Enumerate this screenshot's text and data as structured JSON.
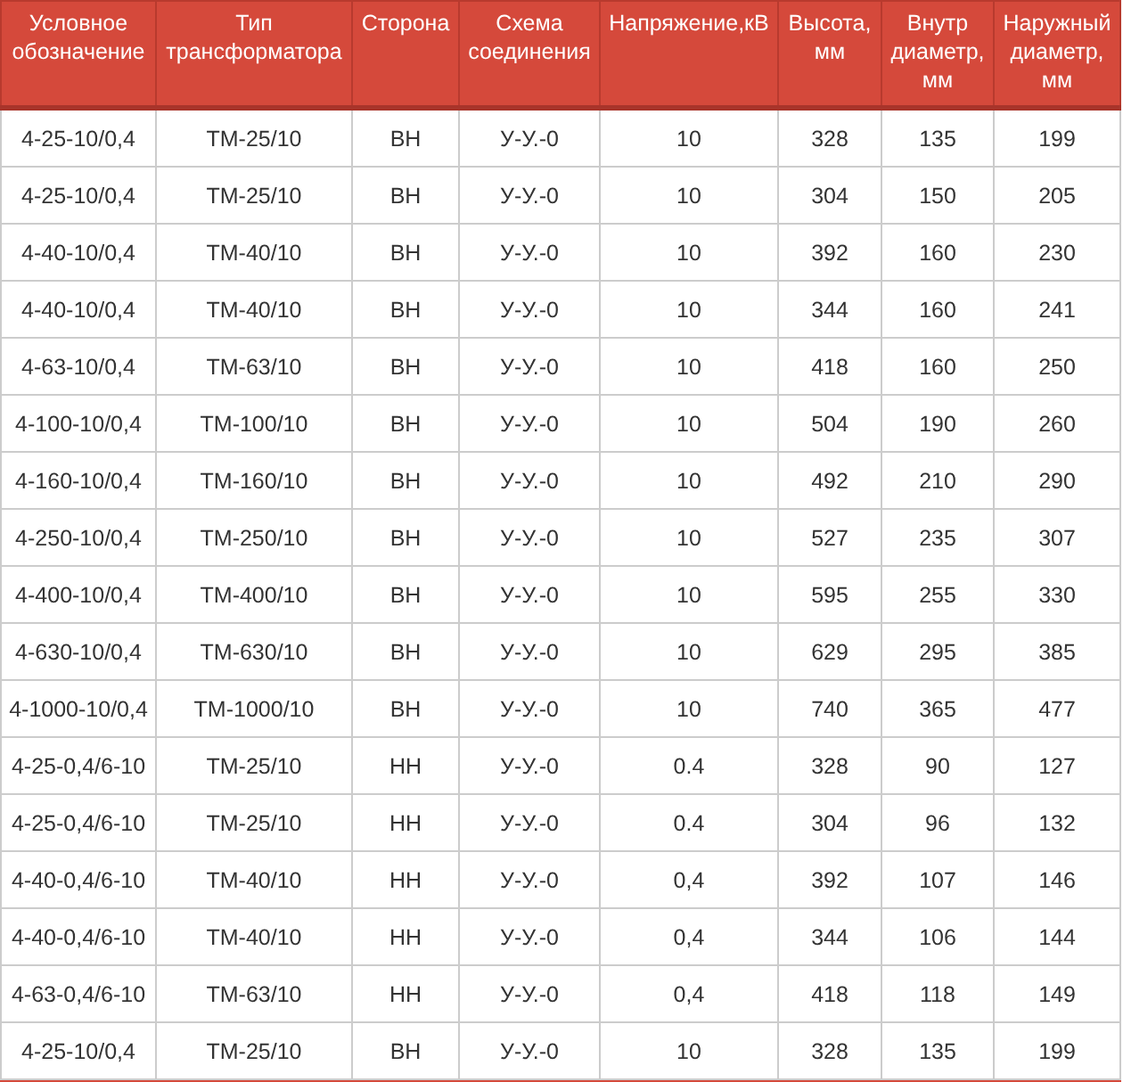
{
  "table": {
    "columns": [
      "Условное обозначение",
      "Тип трансформатора",
      "Сторона",
      "Схема соединения",
      "Напряжение,кВ",
      "Высота, мм",
      "Внутр диаметр, мм",
      "Наружный диаметр, мм"
    ],
    "rows": [
      [
        "4-25-10/0,4",
        "ТМ-25/10",
        "ВН",
        "У-У.-0",
        "10",
        "328",
        "135",
        "199"
      ],
      [
        "4-25-10/0,4",
        "ТМ-25/10",
        "ВН",
        "У-У.-0",
        "10",
        "304",
        "150",
        "205"
      ],
      [
        "4-40-10/0,4",
        "ТМ-40/10",
        "ВН",
        "У-У.-0",
        "10",
        "392",
        "160",
        "230"
      ],
      [
        "4-40-10/0,4",
        "ТМ-40/10",
        "ВН",
        "У-У.-0",
        "10",
        "344",
        "160",
        "241"
      ],
      [
        "4-63-10/0,4",
        "ТМ-63/10",
        "ВН",
        "У-У.-0",
        "10",
        "418",
        "160",
        "250"
      ],
      [
        "4-100-10/0,4",
        "ТМ-100/10",
        "ВН",
        "У-У.-0",
        "10",
        "504",
        "190",
        "260"
      ],
      [
        "4-160-10/0,4",
        "ТМ-160/10",
        "ВН",
        "У-У.-0",
        "10",
        "492",
        "210",
        "290"
      ],
      [
        "4-250-10/0,4",
        "ТМ-250/10",
        "ВН",
        "У-У.-0",
        "10",
        "527",
        "235",
        "307"
      ],
      [
        "4-400-10/0,4",
        "ТМ-400/10",
        "ВН",
        "У-У.-0",
        "10",
        "595",
        "255",
        "330"
      ],
      [
        "4-630-10/0,4",
        "ТМ-630/10",
        "ВН",
        "У-У.-0",
        "10",
        "629",
        "295",
        "385"
      ],
      [
        "4-1000-10/0,4",
        "ТМ-1000/10",
        "ВН",
        "У-У.-0",
        "10",
        "740",
        "365",
        "477"
      ],
      [
        "4-25-0,4/6-10",
        "ТМ-25/10",
        "НН",
        "У-У.-0",
        "0.4",
        "328",
        "90",
        "127"
      ],
      [
        "4-25-0,4/6-10",
        "ТМ-25/10",
        "НН",
        "У-У.-0",
        "0.4",
        "304",
        "96",
        "132"
      ],
      [
        "4-40-0,4/6-10",
        "ТМ-40/10",
        "НН",
        "У-У.-0",
        "0,4",
        "392",
        "107",
        "146"
      ],
      [
        "4-40-0,4/6-10",
        "ТМ-40/10",
        "НН",
        "У-У.-0",
        "0,4",
        "344",
        "106",
        "144"
      ],
      [
        "4-63-0,4/6-10",
        "ТМ-63/10",
        "НН",
        "У-У.-0",
        "0,4",
        "418",
        "118",
        "149"
      ],
      [
        "4-25-10/0,4",
        "ТМ-25/10",
        "ВН",
        "У-У.-0",
        "10",
        "328",
        "135",
        "199"
      ]
    ]
  }
}
